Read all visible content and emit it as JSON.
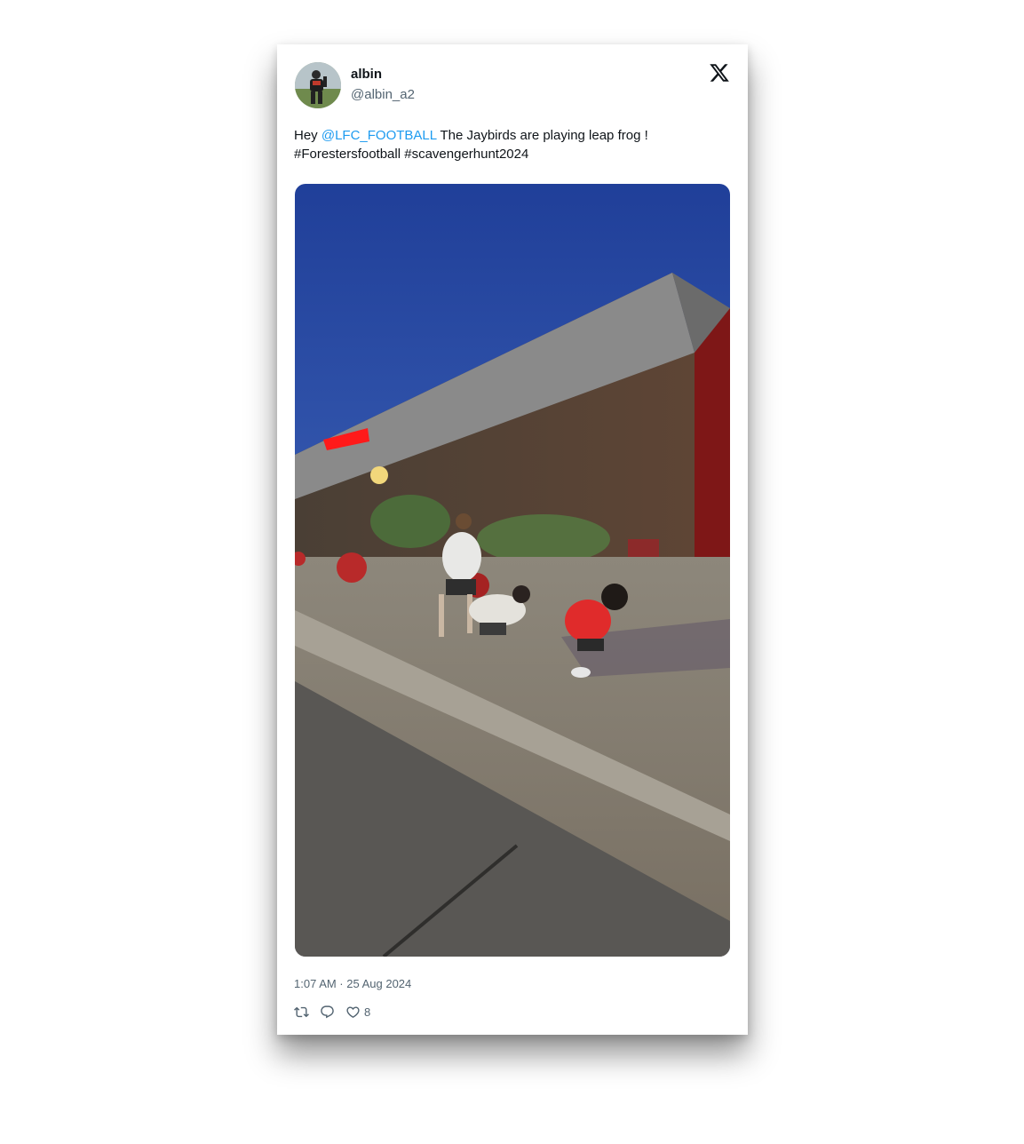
{
  "user": {
    "display_name": "albin",
    "handle": "@albin_a2"
  },
  "tweet": {
    "text_prefix": "Hey ",
    "mention": "@LFC_FOOTBALL",
    "text_suffix": " The Jaybirds are playing leap frog !",
    "hashtags": "#Forestersfootball #scavengerhunt2024",
    "timestamp": "1:07 AM · 25 Aug 2024",
    "like_count": "8"
  },
  "icons": {
    "brand": "x-logo-icon",
    "retweet": "retweet-icon",
    "reply": "reply-icon",
    "like": "heart-icon"
  },
  "colors": {
    "link": "#1d9bf0",
    "text": "#0f1419",
    "secondary": "#536471"
  }
}
